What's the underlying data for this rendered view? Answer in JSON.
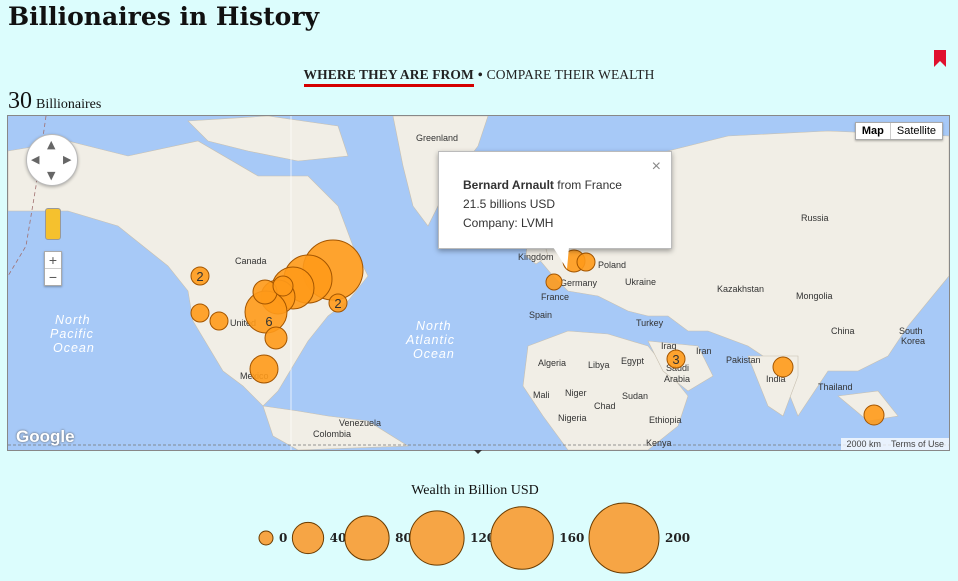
{
  "header": {
    "title": "Billionaires in History"
  },
  "nav": {
    "active": "WHERE THEY ARE FROM",
    "separator": "•",
    "other": "COMPARE THEIR WEALTH"
  },
  "count": {
    "number": "30",
    "label": "Billionaires"
  },
  "map": {
    "type_buttons": [
      "Map",
      "Satellite"
    ],
    "labels": {
      "greenland": "Greenland",
      "canada": "Canada",
      "north_pacific": [
        "North",
        "Pacific",
        "Ocean"
      ],
      "north_atlantic": [
        "North",
        "Atlantic",
        "Ocean"
      ],
      "united": "United",
      "mexico": "Mexico",
      "venezuela": "Venezuela",
      "colombia": "Colombia",
      "kingdom": "Kingdom",
      "france": "France",
      "germany": "Germany",
      "poland": "Poland",
      "spain": "Spain",
      "ukraine": "Ukraine",
      "kazakhstan": "Kazakhstan",
      "mongolia": "Mongolia",
      "russia": "Russia",
      "turkey": "Turkey",
      "iran": "Iran",
      "iraq": "Iraq",
      "pakistan": "Pakistan",
      "china": "China",
      "south_korea": [
        "South",
        "Korea"
      ],
      "india": "India",
      "thailand": "Thailand",
      "saudi_arabia": [
        "Saudi",
        "Arabia"
      ],
      "egypt": "Egypt",
      "libya": "Libya",
      "algeria": "Algeria",
      "mali": "Mali",
      "niger": "Niger",
      "nigeria": "Nigeria",
      "chad": "Chad",
      "sudan": "Sudan",
      "ethiopia": "Ethiopia",
      "kenya": "Kenya"
    },
    "cluster_counts": [
      "2",
      "2",
      "6",
      "3"
    ],
    "info": {
      "name": "Bernard Arnault",
      "from_text": "from France",
      "wealth": "21.5 billions USD",
      "company": "Company: LVMH"
    },
    "google": "Google",
    "scale": "2000 km",
    "terms": "Terms of Use"
  },
  "legend": {
    "title": "Wealth in Billion USD",
    "items": [
      {
        "value": 0,
        "label": "0"
      },
      {
        "value": 40,
        "label": "40"
      },
      {
        "value": 80,
        "label": "80"
      },
      {
        "value": 120,
        "label": "120"
      },
      {
        "value": 160,
        "label": "160"
      },
      {
        "value": 200,
        "label": "200"
      }
    ]
  },
  "colors": {
    "bubble": "#ff9a1a",
    "nav_underline": "#d40000",
    "background": "#dcfdfd",
    "ocean": "#a7c9f7",
    "land": "#f1eee6"
  }
}
